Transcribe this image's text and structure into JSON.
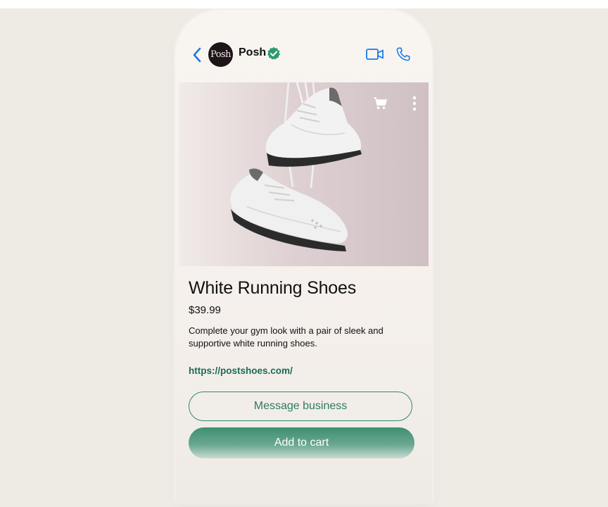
{
  "header": {
    "back_icon": "chevron-left-icon",
    "avatar_text": "Posh",
    "business_name": "Posh",
    "verified_icon": "verified-badge-icon",
    "video_icon": "video-camera-icon",
    "call_icon": "phone-icon"
  },
  "product": {
    "image": "white-sneakers-hanging-by-laces",
    "cart_icon": "cart-icon",
    "more_icon": "more-vertical-icon",
    "title": "White Running Shoes",
    "price": "$39.99",
    "description": "Complete your gym look with a pair of sleek and supportive white running shoes.",
    "link": "https://postshoes.com/"
  },
  "actions": {
    "message_label": "Message business",
    "add_to_cart_label": "Add to cart"
  },
  "colors": {
    "accent_blue": "#1a7ae6",
    "verified_green": "#2e9a6f",
    "brand_green": "#3d8f73",
    "link_green": "#1d6c55",
    "avatar_bg": "#1d1518"
  }
}
